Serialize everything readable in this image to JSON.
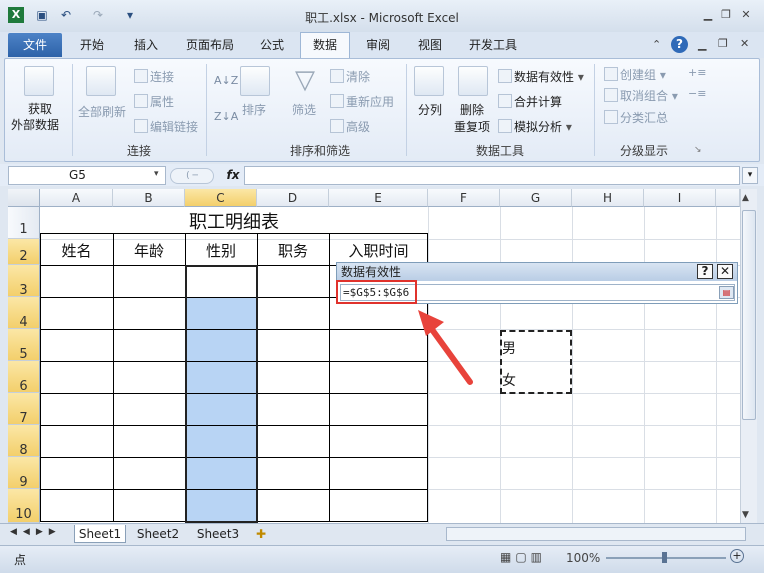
{
  "window": {
    "title": "职工.xlsx - Microsoft Excel"
  },
  "tabs": [
    "文件",
    "开始",
    "插入",
    "页面布局",
    "公式",
    "数据",
    "审阅",
    "视图",
    "开发工具"
  ],
  "ribbon": {
    "get_external_1": "获取",
    "get_external_2": "外部数据",
    "refresh_all": "全部刷新",
    "connections": "连接",
    "properties": "属性",
    "edit_links": "编辑链接",
    "sort": "排序",
    "filter": "筛选",
    "clear": "清除",
    "reapply": "重新应用",
    "advanced": "高级",
    "text_to_columns": "分列",
    "remove_duplicates_1": "删除",
    "remove_duplicates_2": "重复项",
    "data_validation": "数据有效性",
    "consolidate": "合并计算",
    "what_if": "模拟分析",
    "group": "创建组",
    "ungroup": "取消组合",
    "subtotal": "分类汇总",
    "groups": {
      "connections": "连接",
      "sort_filter": "排序和筛选",
      "data_tools": "数据工具",
      "outline": "分级显示"
    }
  },
  "formula_bar": {
    "name_box": "G5",
    "fx": "fx"
  },
  "columns": [
    "A",
    "B",
    "C",
    "D",
    "E",
    "F",
    "G",
    "H",
    "I"
  ],
  "rows": [
    "1",
    "2",
    "3",
    "4",
    "5",
    "6",
    "7",
    "8",
    "9",
    "10"
  ],
  "sheet": {
    "title": "职工明细表",
    "headers": [
      "姓名",
      "年龄",
      "性别",
      "职务",
      "入职时间"
    ],
    "list_values": [
      "男",
      "女"
    ]
  },
  "dialog": {
    "title": "数据有效性",
    "help": "?",
    "close": "✕",
    "formula": "=$G$5:$G$6"
  },
  "sheet_tabs": [
    "Sheet1",
    "Sheet2",
    "Sheet3"
  ],
  "status": {
    "mode": "点",
    "zoom": "100%"
  }
}
